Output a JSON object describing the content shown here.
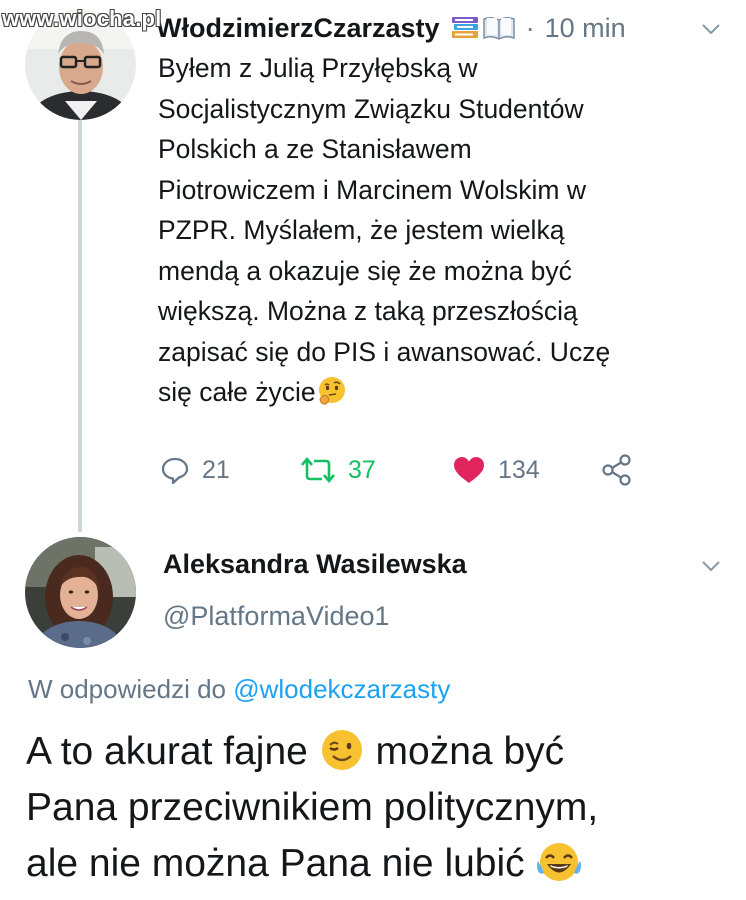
{
  "watermark": {
    "text": "www.wiocha.pl"
  },
  "tweet1": {
    "display_name": "WłodzimierzCzarzasty",
    "name_emojis": [
      "books-emoji",
      "open-book-emoji"
    ],
    "separator": "·",
    "time": "10 min",
    "lines": [
      "Byłem z Julią Przyłębską w",
      "Socjalistycznym Związku Studentów",
      "Polskich a ze Stanisławem",
      "Piotrowiczem i Marcinem Wolskim w",
      "PZPR. Myślałem, że jestem wielką",
      "mendą a okazuje się że można być",
      "większą. Można z taką przeszłością",
      "zapisać się do PIS i awansować. Uczę",
      "się całe życie"
    ],
    "trailing_emoji": "thinking-face-emoji",
    "actions": {
      "replies": "21",
      "retweets": "37",
      "likes": "134"
    }
  },
  "tweet2": {
    "display_name": "Aleksandra Wasilewska",
    "handle": "@PlatformaVideo1",
    "replying_prefix": "W odpowiedzi do",
    "replying_to": "@wlodekczarzasty",
    "line1_a": "A to akurat fajne",
    "line1_b": "można być",
    "line2": "Pana przeciwnikiem politycznym,",
    "line3": "ale nie można Pana nie lubić"
  },
  "colors": {
    "text": "#14171a",
    "muted": "#657786",
    "link": "#1da1f2",
    "retweet": "#17bf63",
    "like": "#e0245e",
    "thread_line": "#ccd6dd"
  }
}
